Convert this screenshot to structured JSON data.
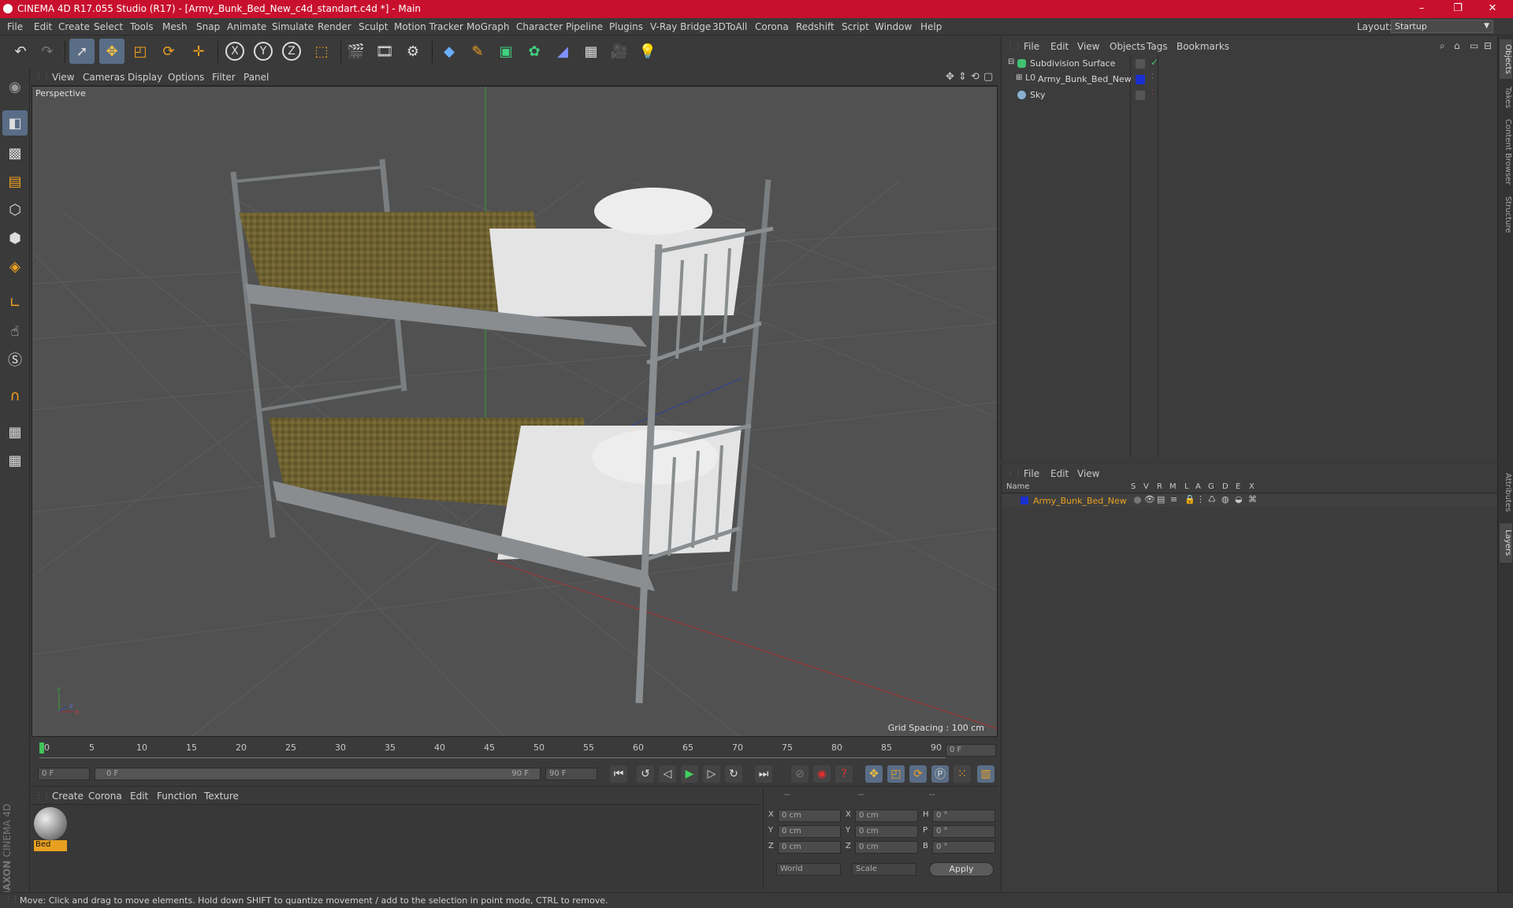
{
  "window": {
    "title": "CINEMA 4D R17.055 Studio (R17) - [Army_Bunk_Bed_New_c4d_standart.c4d *] - Main",
    "controls": [
      "–",
      "❐",
      "✕"
    ]
  },
  "menubar": {
    "items": [
      "File",
      "Edit",
      "Create",
      "Select",
      "Tools",
      "Mesh",
      "Snap",
      "Animate",
      "Simulate",
      "Render",
      "Sculpt",
      "Motion Tracker",
      "MoGraph",
      "Character",
      "Pipeline",
      "Plugins",
      "V-Ray Bridge",
      "3DToAll",
      "Corona",
      "Redshift",
      "Script",
      "Window",
      "Help"
    ],
    "layout_label": "Layout:",
    "layout_value": "Startup"
  },
  "toolbar": {
    "axis_x": "X",
    "axis_y": "Y",
    "axis_z": "Z"
  },
  "viewport": {
    "menu": [
      "View",
      "Cameras",
      "Display",
      "Options",
      "Filter",
      "Panel"
    ],
    "label": "Perspective",
    "grid_spacing": "Grid Spacing : 100 cm",
    "axis_x": "x",
    "axis_y": "y",
    "axis_z": "z"
  },
  "timeline": {
    "ticks": [
      "0",
      "5",
      "10",
      "15",
      "20",
      "25",
      "30",
      "35",
      "40",
      "45",
      "50",
      "55",
      "60",
      "65",
      "70",
      "75",
      "80",
      "85",
      "90"
    ],
    "current_frame": "0 F"
  },
  "transport": {
    "start_field": "0 F",
    "range_start": "0 F",
    "range_end": "90 F",
    "end_field": "90 F"
  },
  "material_manager": {
    "menu": [
      "Create",
      "Corona",
      "Edit",
      "Function",
      "Texture"
    ],
    "materials": [
      {
        "name": "Bed"
      }
    ]
  },
  "coordinates": {
    "header_a": "--",
    "header_b": "--",
    "header_c": "--",
    "rows": [
      {
        "l1": "X",
        "v1": "0 cm",
        "l2": "X",
        "v2": "0 cm",
        "l3": "H",
        "v3": "0 °"
      },
      {
        "l1": "Y",
        "v1": "0 cm",
        "l2": "Y",
        "v2": "0 cm",
        "l3": "P",
        "v3": "0 °"
      },
      {
        "l1": "Z",
        "v1": "0 cm",
        "l2": "Z",
        "v2": "0 cm",
        "l3": "B",
        "v3": "0 °"
      }
    ],
    "mode_world": "World",
    "mode_scale": "Scale",
    "apply": "Apply"
  },
  "object_manager": {
    "menu": [
      "File",
      "Edit",
      "View",
      "Objects",
      "Tags",
      "Bookmarks"
    ],
    "objects": [
      {
        "name": "Subdivision Surface"
      },
      {
        "name": "Army_Bunk_Bed_New"
      },
      {
        "name": "Sky"
      }
    ]
  },
  "layer_manager": {
    "menu": [
      "File",
      "Edit",
      "View"
    ],
    "col_name": "Name",
    "cols": [
      "S",
      "V",
      "R",
      "M",
      "L",
      "A",
      "G",
      "D",
      "E",
      "X"
    ],
    "layers": [
      {
        "name": "Army_Bunk_Bed_New"
      }
    ]
  },
  "right_tabs": [
    "Objects",
    "Takes",
    "Content Browser",
    "Structure",
    "Attributes",
    "Layers"
  ],
  "status": "Move: Click and drag to move elements. Hold down SHIFT to quantize movement / add to the selection in point mode, CTRL to remove.",
  "branding": {
    "maxon": "MAXON",
    "cinema": "CINEMA 4D"
  },
  "colors": {
    "titlebar": "#c8102e",
    "selected_tool": "#5a6d86",
    "layer_name": "#e8a020",
    "layer_color": "#1a2fd0",
    "material_label_bg": "#e8a020"
  }
}
